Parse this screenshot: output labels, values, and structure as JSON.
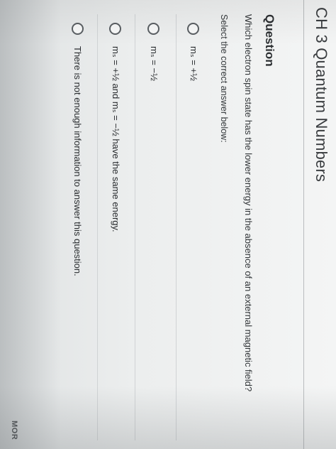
{
  "page": {
    "title": "CH 3 Quantum Numbers",
    "more_label": "MOR"
  },
  "question": {
    "heading": "Question",
    "text": "Which electron spin state has the lower energy in the absence of an external magnetic field?",
    "instruction": "Select the correct answer below:",
    "options": [
      {
        "label": "mₛ = +½",
        "selected": false
      },
      {
        "label": "mₛ = −½",
        "selected": false
      },
      {
        "label": "mₛ = +½ and mₛ = −½ have the same energy.",
        "selected": false
      },
      {
        "label": "There is not enough information to answer this question.",
        "selected": false
      }
    ]
  }
}
